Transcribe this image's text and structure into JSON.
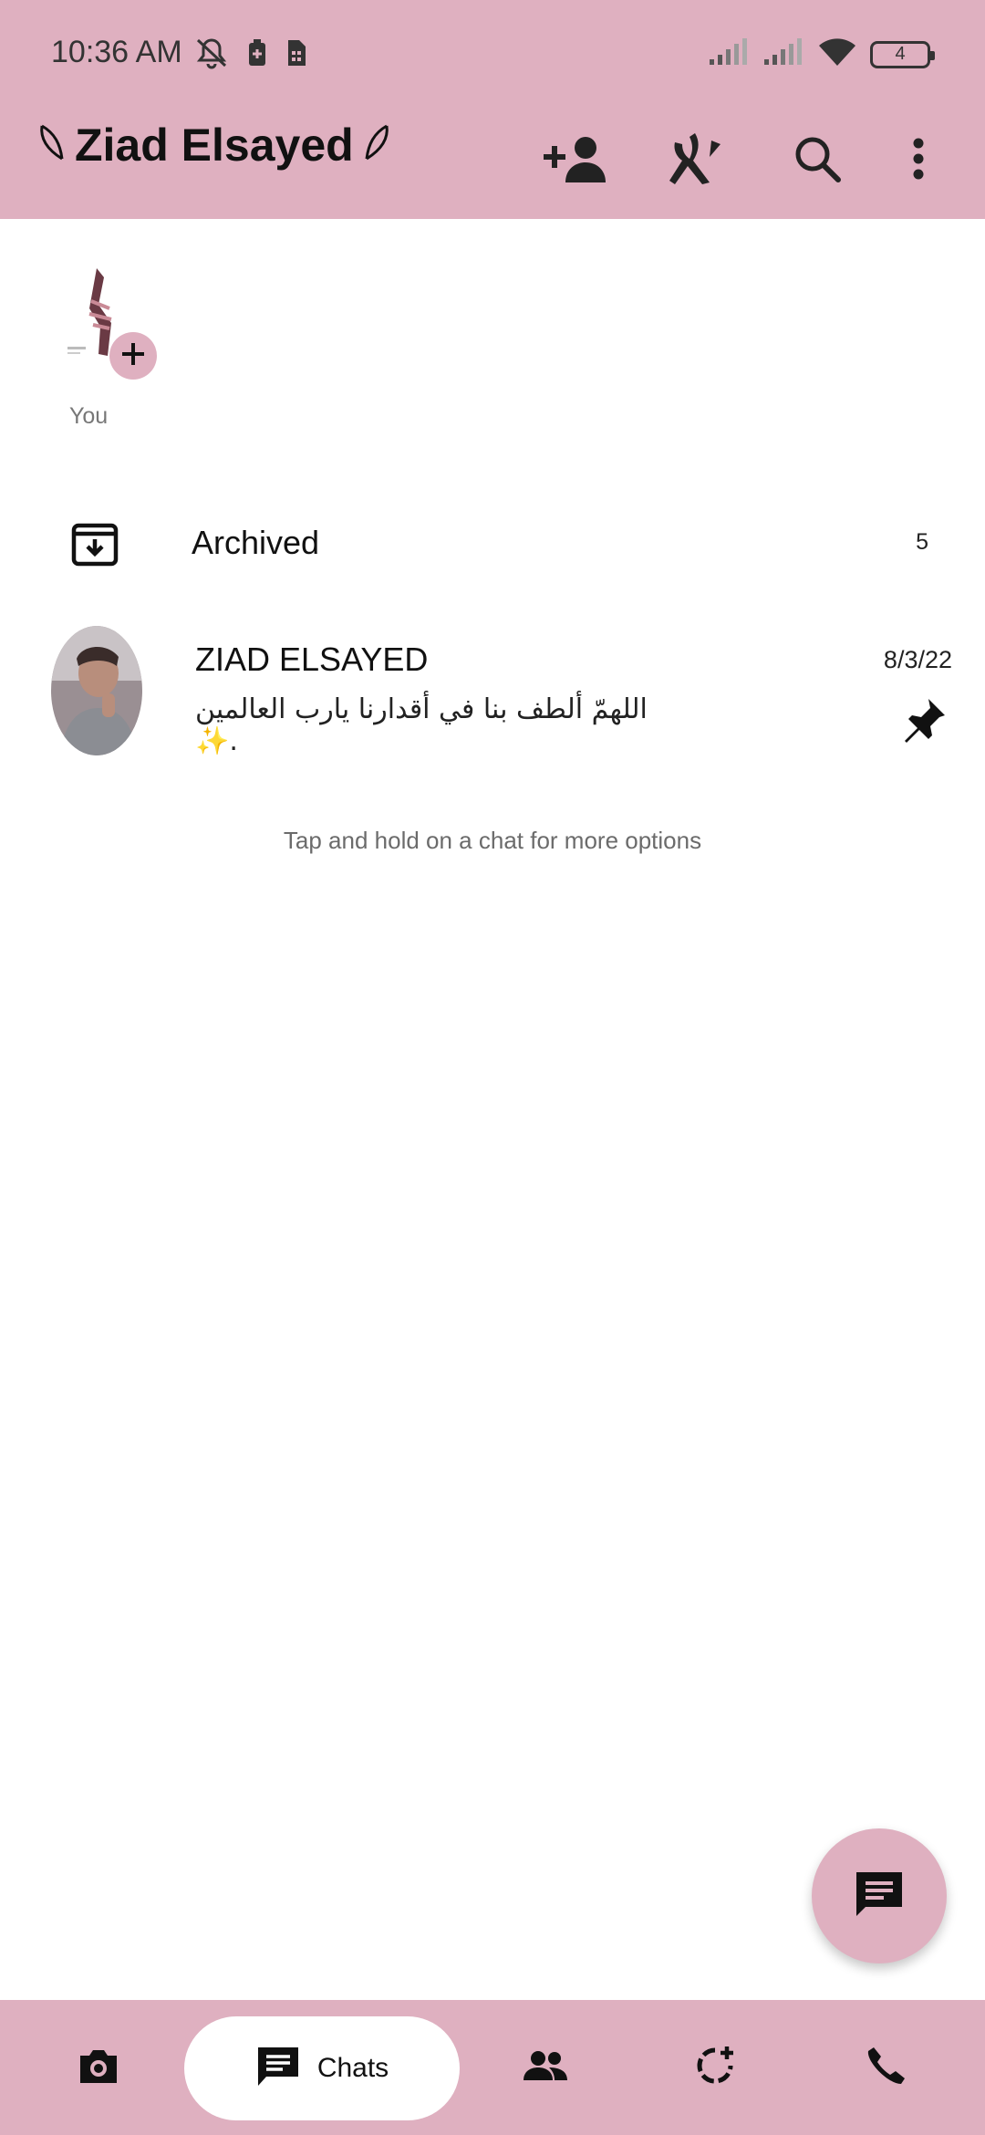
{
  "status_bar": {
    "time": "10:36 AM",
    "battery": "4",
    "icons": [
      "mute-notifications-icon",
      "battery-saver-icon",
      "sim-card-icon",
      "signal-icon",
      "signal-icon",
      "wifi-icon",
      "battery-icon"
    ]
  },
  "app_bar": {
    "title": "Ziad Elsayed",
    "actions": [
      "add-contact-icon",
      "broadcast-icon",
      "search-icon",
      "more-options-icon"
    ]
  },
  "status": {
    "label": "You"
  },
  "archived": {
    "label": "Archived",
    "count": "5"
  },
  "chats": [
    {
      "name": "ZIAD ELSAYED",
      "date": "8/3/22",
      "preview": "اللهمّ ألطف بنا في أقدارنا يارب العالمين ✨.",
      "pinned": true
    }
  ],
  "hint": "Tap and hold on a chat for more options",
  "bottom_nav": {
    "chats_label": "Chats"
  },
  "colors": {
    "accent": "#dfb0c0",
    "background": "#ffffff"
  }
}
